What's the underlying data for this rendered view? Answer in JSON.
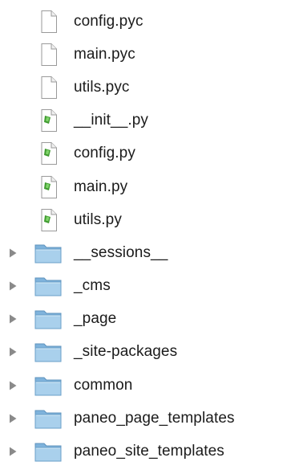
{
  "tree": {
    "items": [
      {
        "type": "file",
        "label": "config.pyc",
        "icon": "document-icon"
      },
      {
        "type": "file",
        "label": "main.pyc",
        "icon": "document-icon"
      },
      {
        "type": "file",
        "label": "utils.pyc",
        "icon": "document-icon"
      },
      {
        "type": "pyfile",
        "label": "__init__.py",
        "icon": "python-script-icon"
      },
      {
        "type": "pyfile",
        "label": "config.py",
        "icon": "python-script-icon"
      },
      {
        "type": "pyfile",
        "label": "main.py",
        "icon": "python-script-icon"
      },
      {
        "type": "pyfile",
        "label": "utils.py",
        "icon": "python-script-icon"
      },
      {
        "type": "folder",
        "label": "__sessions__",
        "icon": "folder-icon"
      },
      {
        "type": "folder",
        "label": "_cms",
        "icon": "folder-icon"
      },
      {
        "type": "folder",
        "label": "_page",
        "icon": "folder-icon"
      },
      {
        "type": "folder",
        "label": "_site-packages",
        "icon": "folder-icon"
      },
      {
        "type": "folder",
        "label": "common",
        "icon": "folder-icon"
      },
      {
        "type": "folder",
        "label": "paneo_page_templates",
        "icon": "folder-icon"
      },
      {
        "type": "folder",
        "label": "paneo_site_templates",
        "icon": "folder-icon"
      }
    ]
  },
  "colors": {
    "folder_body": "#8fbfe3",
    "folder_tab": "#a9d0ec",
    "script_badge": "#3f9a2f",
    "triangle": "#8a8a8a"
  }
}
